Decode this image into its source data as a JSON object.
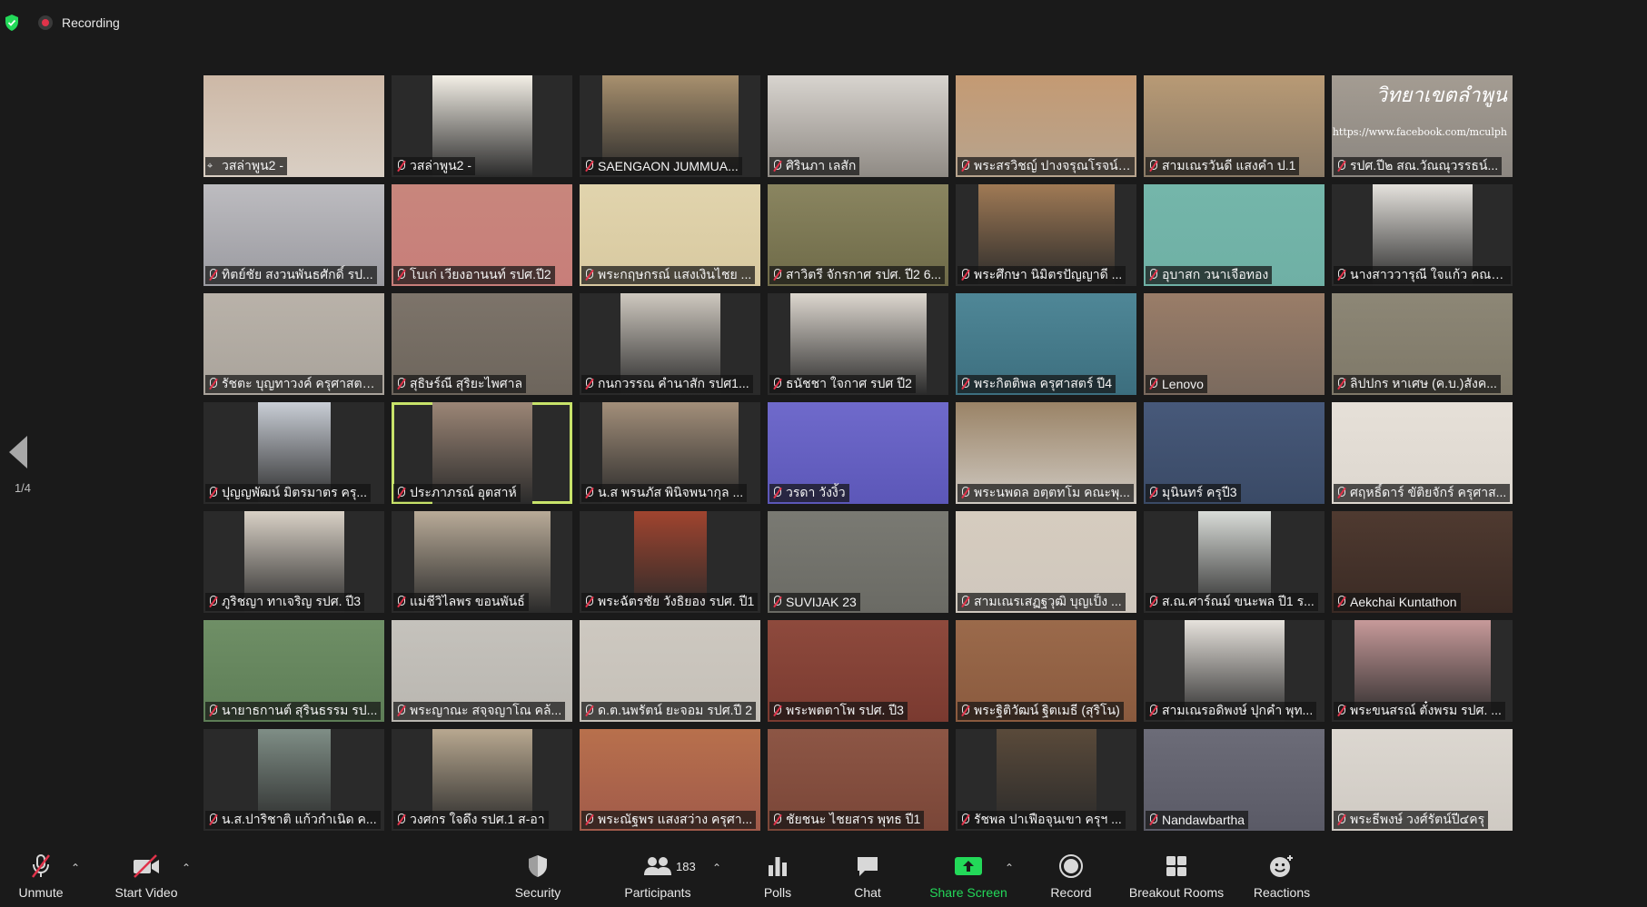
{
  "window": {
    "recording_label": "Recording",
    "security_status_icon": "shield-check-icon"
  },
  "gallery": {
    "page_indicator": "1/4",
    "active_index": 22,
    "tiles": [
      {
        "name": "วสล่าพูน2 -",
        "pinned": true,
        "bg": "#d9cfc4",
        "video": "#cdb8a6"
      },
      {
        "name": "วสล่าพูน2 -",
        "bg": "#2a2a2a",
        "video": "#f3efe6"
      },
      {
        "name": "SAENGAON JUMMUA...",
        "bg": "#2a2a2a",
        "video": "#a8906e"
      },
      {
        "name": "ศิรินภา เลสัก",
        "bg": "#8f8a84",
        "video": "#d8d4cf"
      },
      {
        "name": "พระสรวิชญ์ ปางจรุณโรจน์ ...",
        "bg": "#b7a48e",
        "video": "#c49a73"
      },
      {
        "name": "สามเณรวันดี แสงคำ ป.1",
        "bg": "#8a7a66",
        "video": "#b89a75"
      },
      {
        "name": "รปศ.ปี๒  สณ.วัณณุวรรธน์...",
        "bg": "#8b8680",
        "video": "#a49c92"
      },
      {
        "name": "ทิตย์ชัย สงวนพันธศักดิ์ รป...",
        "bg": "#9a9aa0",
        "video": "#bdbcc0"
      },
      {
        "name": "โบเก่ เวียงอานนท์ รปศ.ปี2",
        "bg": "#c87e7a",
        "video": "#c8867c"
      },
      {
        "name": "พระกฤษกรณ์  แสงเงินไชย ...",
        "bg": "#d8c9a0",
        "video": "#e1d4ad"
      },
      {
        "name": "สาวิตรี จักรกาศ รปศ. ปี2 6...",
        "bg": "#6e6a48",
        "video": "#8a8560"
      },
      {
        "name": "พระศึกษา นิมิตรปัญญาดี ...",
        "bg": "#2a2a2a",
        "video": "#a07a55"
      },
      {
        "name": "อุบาสก วนาเจือทอง",
        "bg": "#6fb0a5",
        "video": "#74b6aa"
      },
      {
        "name": "นางสาววารุณี ใจแก้ว คณะ...",
        "bg": "#2a2a2a",
        "video": "#e5e2dd"
      },
      {
        "name": "รัชตะ บุญทาวงค์ ครุศาสตร์...",
        "bg": "#a9a39b",
        "video": "#b9b2a9"
      },
      {
        "name": "สุธิษร์ณี สุริยะไพศาล",
        "bg": "#6d655c",
        "video": "#7d746a"
      },
      {
        "name": "กนกวรรณ คำนาสัก รปศ1...",
        "bg": "#2a2a2a",
        "video": "#cfc9c0"
      },
      {
        "name": "ธนัชชา ใจกาศ รปศ ปี2",
        "bg": "#2a2a2a",
        "video": "#ddd7cf"
      },
      {
        "name": "พระกิตติพล ครุศาสตร์ ปี4",
        "bg": "#3c6e7e",
        "video": "#4f8797"
      },
      {
        "name": "Lenovo",
        "bg": "#7a6a5e",
        "video": "#9a7d68"
      },
      {
        "name": "ลิปปกร หาเศษ  (ค.บ.)สังค...",
        "bg": "#7e7868",
        "video": "#8d8776"
      },
      {
        "name": "ปุญญพัฒน์  มิตรมาตร ครุ...",
        "bg": "#2a2a2a",
        "video": "#c9ced6"
      },
      {
        "name": "ประภาภรณ์ อุตสาห์",
        "bg": "#2a2a2a",
        "video": "#9c8676"
      },
      {
        "name": "น.ส พรนภัส พินิจพนากุล ...",
        "bg": "#2a2a2a",
        "video": "#a38f7a"
      },
      {
        "name": "วรดา วังงิ้ว",
        "bg": "#5c57b8",
        "video": "#6f6acb"
      },
      {
        "name": "พระนพดล อตฺตทโม คณะพุ...",
        "bg": "#cfc9c1",
        "video": "#9a8366"
      },
      {
        "name": "มุนินทร์ ครุปี3",
        "bg": "#3a4a66",
        "video": "#47597a"
      },
      {
        "name": "ศฤหธิ์ดาร์ ขัติยจักร์ ครุศาส...",
        "bg": "#ddd7cf",
        "video": "#e6e0d8"
      },
      {
        "name": "ภูริชญา ทาเจริญ รปศ. ปี3",
        "bg": "#2a2a2a",
        "video": "#d9d1c6"
      },
      {
        "name": "แม่ชีวิไลพร ขอนพันธ์",
        "bg": "#2a2a2a",
        "video": "#b9ab98"
      },
      {
        "name": "พระฉัตรชัย วังธิยอง รปศ. ปี1",
        "bg": "#2a2a2a",
        "video": "#a0442f"
      },
      {
        "name": "SUVIJAK 23",
        "bg": "#6a6a64",
        "video": "#7a7a73"
      },
      {
        "name": "สามเณรเสฏฐวุฒิ  บุญเป็ง ...",
        "bg": "#cfc7bd",
        "video": "#d6ccbf"
      },
      {
        "name": "ส.ณ.ศาร์ณม์ ขนะพล ปี1 ร...",
        "bg": "#2a2a2a",
        "video": "#d9dcd8"
      },
      {
        "name": "Aekchai  Kuntathon",
        "bg": "#3a2a24",
        "video": "#4f3a30"
      },
      {
        "name": "นายาธกานต์ สุรินธรรม รป...",
        "bg": "#5d7d56",
        "video": "#6f8f66"
      },
      {
        "name": "พระญาณะ สจฺจญาโณ คล้...",
        "bg": "#b9b6b0",
        "video": "#c5c2bc"
      },
      {
        "name": "ด.ต.นพรัตน์ ยะจอม รปศ.ปี 2",
        "bg": "#c5c0b8",
        "video": "#cdc8c0"
      },
      {
        "name": "พระพตตาโพ รปศ. ปี3",
        "bg": "#7a3a30",
        "video": "#8e4a3d"
      },
      {
        "name": "พระฐิติวัฒน์ ฐิตเมธี (สุริโน)",
        "bg": "#8a5a3e",
        "video": "#9b6a4b"
      },
      {
        "name": "สามเณรอดิพงษ์ ปุกคำ พุท...",
        "bg": "#2a2a2a",
        "video": "#e6e2dc"
      },
      {
        "name": "พระขนสรณ์ ตั๋งพรม รปศ. ...",
        "bg": "#2a2a2a",
        "video": "#c79a9a"
      },
      {
        "name": "น.ส.ปาริชาติ แก้วกำเนิด ค...",
        "bg": "#2a2a2a",
        "video": "#7f8e86"
      },
      {
        "name": "วงศกร ใจดึง รปศ.1 ส-อา",
        "bg": "#2a2a2a",
        "video": "#b8a890"
      },
      {
        "name": "พระณัฐพร แสงสว่าง ครุศา...",
        "bg": "#a05a4a",
        "video": "#b8704c"
      },
      {
        "name": "ชัยชนะ ไชยสาร พุทธ ปี1",
        "bg": "#7a4638",
        "video": "#8d5645"
      },
      {
        "name": "รัชพล ปาเฟือจุนเขา ครุฯ ...",
        "bg": "#2a2a2a",
        "video": "#5a4a3a"
      },
      {
        "name": "Nandawbartha",
        "bg": "#5a5a66",
        "video": "#6c6c78"
      },
      {
        "name": "พระธีพงษ์ วงศ์รัตน์ปี๔ครุ",
        "bg": "#cfcac3",
        "video": "#dcd7d0"
      }
    ],
    "overlay_lines": [
      "วิทยาเขตลำพูน",
      "https://www.facebook.com/mculph"
    ]
  },
  "toolbar": {
    "unmute": "Unmute",
    "start_video": "Start Video",
    "security": "Security",
    "participants": "Participants",
    "participants_count": "183",
    "polls": "Polls",
    "chat": "Chat",
    "share_screen": "Share Screen",
    "record": "Record",
    "breakout_rooms": "Breakout Rooms",
    "reactions": "Reactions",
    "share_color": "#23d959",
    "text_color": "#e8e8e8"
  }
}
